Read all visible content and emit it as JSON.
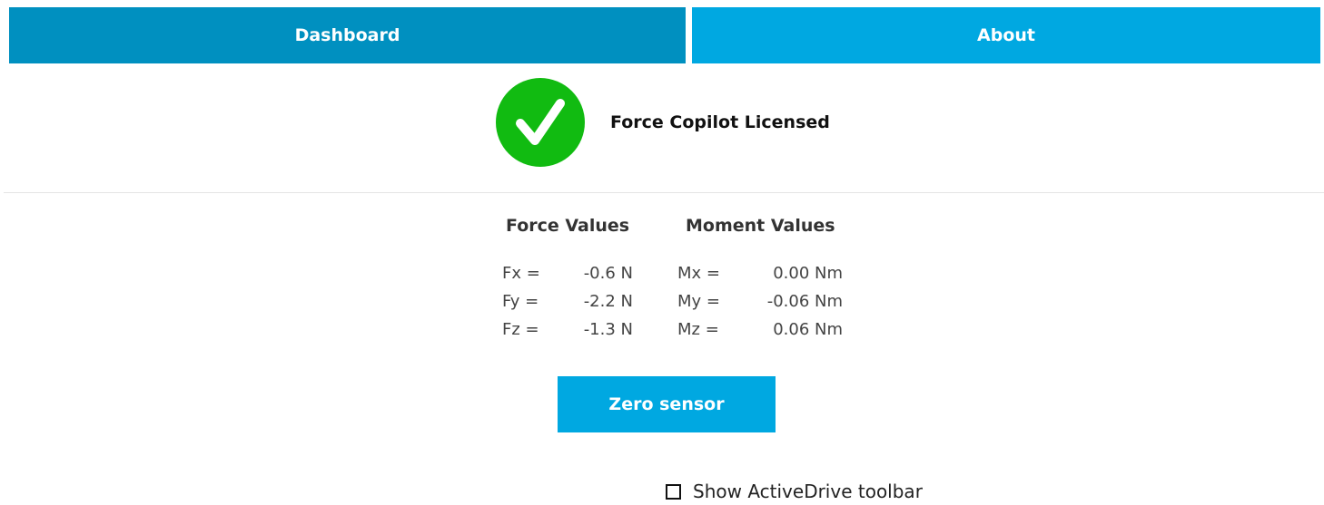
{
  "tabs": {
    "dashboard": "Dashboard",
    "about": "About"
  },
  "license": {
    "icon": "check-circle-icon",
    "text": "Force Copilot Licensed",
    "status_color": "#11bb11"
  },
  "force": {
    "heading": "Force Values",
    "rows": [
      {
        "label": "Fx =",
        "value": "-0.6 N"
      },
      {
        "label": "Fy =",
        "value": "-2.2 N"
      },
      {
        "label": "Fz =",
        "value": "-1.3 N"
      }
    ]
  },
  "moment": {
    "heading": "Moment Values",
    "rows": [
      {
        "label": "Mx =",
        "value": "0.00 Nm"
      },
      {
        "label": "My =",
        "value": "-0.06 Nm"
      },
      {
        "label": "Mz =",
        "value": "0.06 Nm"
      }
    ]
  },
  "actions": {
    "zero_sensor": "Zero sensor"
  },
  "toolbar_toggle": {
    "label": "Show ActiveDrive toolbar",
    "checked": false
  },
  "colors": {
    "accent": "#00a8e1",
    "accent_active": "#0090c0"
  }
}
